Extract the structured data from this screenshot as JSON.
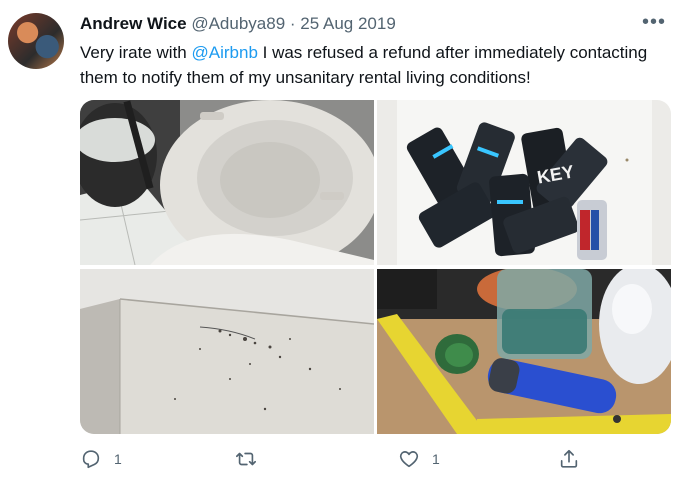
{
  "tweet": {
    "author_name": "Andrew Wice",
    "handle": "@Adubya89",
    "separator": "·",
    "date": "25 Aug 2019",
    "more_glyph": "•••",
    "text_before": "Very irate with ",
    "mention": "@Airbnb",
    "text_after": " I was refused a refund after immediately contacting them to notify them of my unsanitary rental living conditions!"
  },
  "media": [
    {
      "subject": "toilet with lid raised beside trash bin"
    },
    {
      "subject": "bin full of crushed KEY energy drink cans"
    },
    {
      "subject": "dirty floor corner with debris"
    },
    {
      "subject": "drawer with glass jar and blue lighter"
    }
  ],
  "can_label": "KEY",
  "actions": {
    "reply_count": "1",
    "retweet_count": "",
    "like_count": "1"
  },
  "colors": {
    "accent": "#1d9bf0",
    "text": "#0f1419",
    "muted": "#536471"
  }
}
